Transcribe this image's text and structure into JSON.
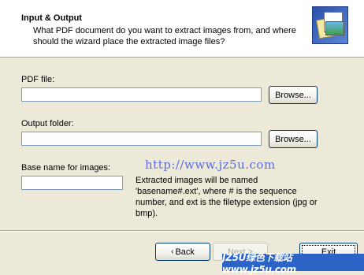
{
  "header": {
    "title": "Input & Output",
    "description": "What PDF document do you want to extract images from, and where should the wizard place the extracted image files?"
  },
  "pdf_file": {
    "label": "PDF file:",
    "value": "",
    "browse_label": "Browse..."
  },
  "output_folder": {
    "label": "Output folder:",
    "value": "",
    "browse_label": "Browse..."
  },
  "base_name": {
    "label": "Base name for images:",
    "value": "",
    "note": "Extracted images will be named 'basename#.ext', where # is the sequence number, and ext is the filetype extension (jpg or bmp)."
  },
  "watermark": "http://www.jz5u.com",
  "buttons": {
    "back": "Back",
    "next": "Next >",
    "exit": "Exit"
  },
  "badge": "JZ5U绿色下载站www.jz5u.com",
  "colors": {
    "accent_border": "#003c74",
    "window_bg": "#ece9d8",
    "watermark": "#5c6ee6"
  }
}
